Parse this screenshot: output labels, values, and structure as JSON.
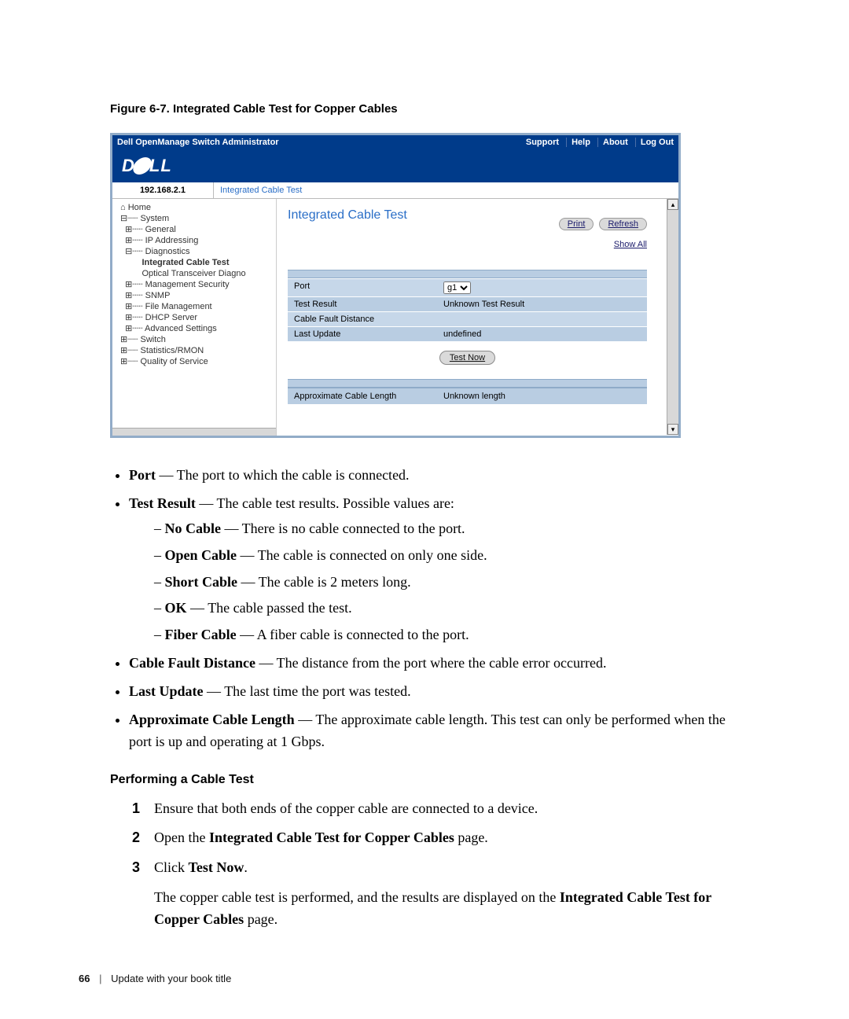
{
  "caption": "Figure 6-7.   Integrated Cable Test for Copper Cables",
  "shot": {
    "titlebar": {
      "title": "Dell OpenManage Switch Administrator",
      "links": [
        "Support",
        "Help",
        "About",
        "Log Out"
      ]
    },
    "logo": "DELL",
    "ip": "192.168.2.1",
    "breadcrumb": "Integrated Cable Test",
    "tree": [
      "⌂ Home",
      "⊟┈┈ System",
      "  ⊞┈┈ General",
      "  ⊞┈┈ IP Addressing",
      "  ⊟┈┈ Diagnostics",
      "         Integrated Cable Test",
      "         Optical Transceiver Diagno",
      "  ⊞┈┈ Management Security",
      "  ⊞┈┈ SNMP",
      "  ⊞┈┈ File Management",
      "  ⊞┈┈ DHCP Server",
      "  ⊞┈┈ Advanced Settings",
      "⊞┈┈ Switch",
      "⊞┈┈ Statistics/RMON",
      "⊞┈┈ Quality of Service"
    ],
    "tree_selected_index": 5,
    "mainTitle": "Integrated Cable Test",
    "buttons": {
      "print": "Print",
      "refresh": "Refresh",
      "showAll": "Show All"
    },
    "rows": [
      {
        "k": "Port",
        "v_select": "g1"
      },
      {
        "k": "Test Result",
        "v": "Unknown Test Result"
      },
      {
        "k": "Cable Fault Distance",
        "v": ""
      },
      {
        "k": "Last Update",
        "v": "undefined"
      }
    ],
    "testNow": "Test Now",
    "approx": {
      "k": "Approximate Cable Length",
      "v": "Unknown length"
    }
  },
  "bullets": [
    {
      "term": "Port",
      "desc": " — The port to which the cable is connected."
    },
    {
      "term": "Test Result",
      "desc": " — The cable test results. Possible values are:",
      "sub": [
        {
          "term": "No Cable",
          "desc": " — There is no cable connected to the port."
        },
        {
          "term": "Open Cable",
          "desc": " — The cable is connected on only one side."
        },
        {
          "term": "Short Cable",
          "desc": " — The cable is 2 meters long."
        },
        {
          "term": "OK",
          "desc": " — The cable passed the test."
        },
        {
          "term": "Fiber Cable",
          "desc": " — A fiber cable is connected to the port."
        }
      ]
    },
    {
      "term": "Cable Fault Distance",
      "desc": " — The distance from the port where the cable error occurred."
    },
    {
      "term": "Last Update",
      "desc": " — The last time the port was tested."
    },
    {
      "term": "Approximate Cable Length",
      "desc": " — The approximate cable length. This test can only be performed when the port is up and operating at 1 Gbps."
    }
  ],
  "section2": "Performing a Cable Test",
  "steps": [
    {
      "n": "1",
      "text": "Ensure that both ends of the copper cable are connected to a device."
    },
    {
      "n": "2",
      "html": "Open the <b>Integrated Cable Test for Copper Cables</b> page."
    },
    {
      "n": "3",
      "html": "Click <b>Test Now</b>.",
      "after": "The copper cable test is performed, and the results are displayed on the <b>Integrated Cable Test for Copper Cables</b> page."
    }
  ],
  "footer": {
    "page": "66",
    "title": "Update with your book title"
  }
}
